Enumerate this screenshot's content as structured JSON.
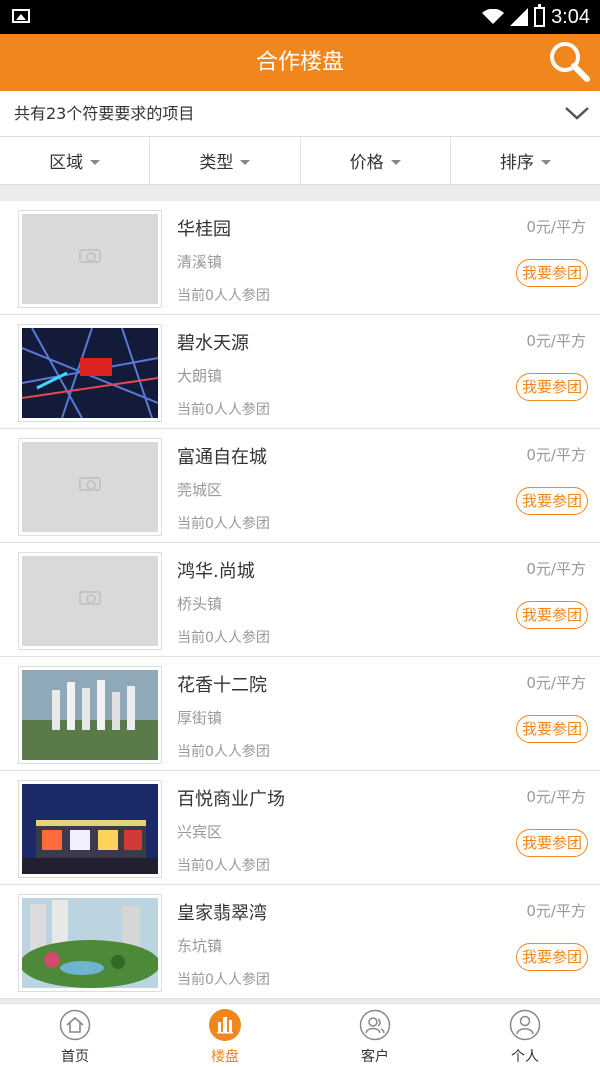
{
  "status_bar": {
    "time": "3:04"
  },
  "header": {
    "title": "合作楼盘"
  },
  "summary": {
    "text": "共有23个符要要求的项目"
  },
  "filters": [
    {
      "label": "区域"
    },
    {
      "label": "类型"
    },
    {
      "label": "价格"
    },
    {
      "label": "排序"
    }
  ],
  "projects": [
    {
      "name": "华桂园",
      "district": "清溪镇",
      "price": "0元/平方",
      "joined": "当前0人人参团",
      "button": "我要参团",
      "image": "placeholder"
    },
    {
      "name": "碧水天源",
      "district": "大朗镇",
      "price": "0元/平方",
      "joined": "当前0人人参团",
      "button": "我要参团",
      "image": "map-aerial-photo"
    },
    {
      "name": "富通自在城",
      "district": "莞城区",
      "price": "0元/平方",
      "joined": "当前0人人参团",
      "button": "我要参团",
      "image": "placeholder"
    },
    {
      "name": "鸿华.尚城",
      "district": "桥头镇",
      "price": "0元/平方",
      "joined": "当前0人人参团",
      "button": "我要参团",
      "image": "placeholder"
    },
    {
      "name": "花香十二院",
      "district": "厚街镇",
      "price": "0元/平方",
      "joined": "当前0人人参团",
      "button": "我要参团",
      "image": "aerial-photo"
    },
    {
      "name": "百悦商业广场",
      "district": "兴宾区",
      "price": "0元/平方",
      "joined": "当前0人人参团",
      "button": "我要参团",
      "image": "night-building-photo"
    },
    {
      "name": "皇家翡翠湾",
      "district": "东坑镇",
      "price": "0元/平方",
      "joined": "当前0人人参团",
      "button": "我要参团",
      "image": "garden-photo"
    }
  ],
  "bottom_nav": [
    {
      "label": "首页",
      "icon": "home-icon"
    },
    {
      "label": "楼盘",
      "icon": "buildings-icon",
      "active": true
    },
    {
      "label": "客户",
      "icon": "customer-icon"
    },
    {
      "label": "个人",
      "icon": "person-icon"
    }
  ],
  "colors": {
    "accent": "#f0861c",
    "background": "#ececec"
  }
}
